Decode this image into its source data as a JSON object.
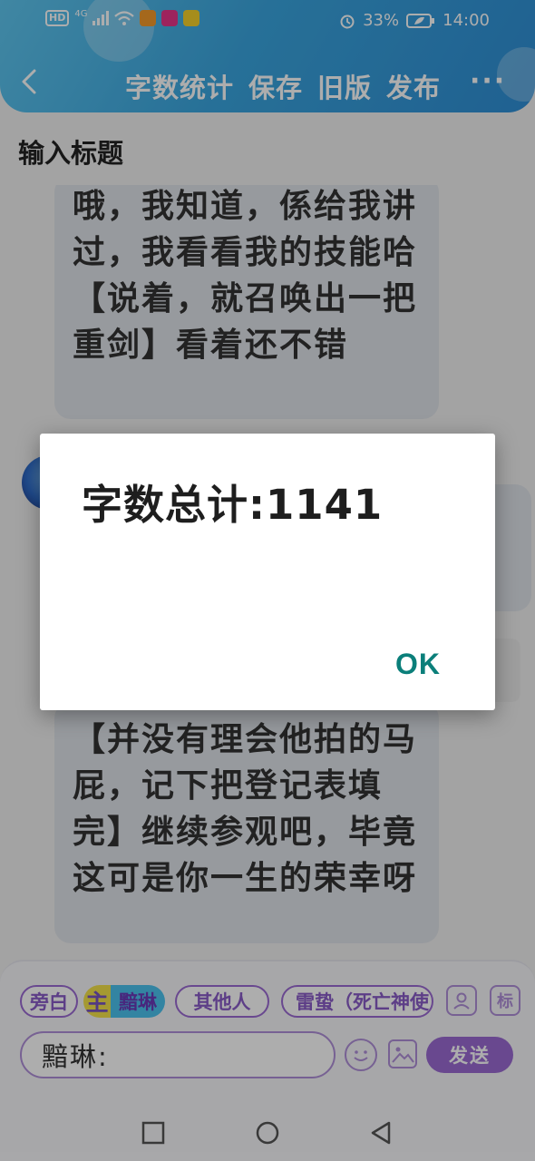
{
  "status_bar": {
    "left_badges": [
      "HD",
      "4G"
    ],
    "battery": "33%",
    "time": "14:00"
  },
  "navbar": {
    "items": [
      "字数统计",
      "保存",
      "旧版",
      "发布"
    ],
    "more": "···"
  },
  "title_placeholder": "输入标题",
  "messages": [
    "哦，我知道，係给我讲过，我看看我的技能哈【说着，就召唤出一把重剑】看着还不错",
    "【并没有理会他拍的马屁，记下把登记表填完】继续参观吧，毕竟这可是你一生的荣幸呀"
  ],
  "role_bar": {
    "narration": "旁白",
    "main_prefix": "主",
    "main_name": "黯琳",
    "others": "其他人",
    "role3": "雷蛰（死亡神使",
    "mark_label": "标"
  },
  "input": {
    "value": "黯琳:",
    "send": "发送"
  },
  "dialog": {
    "message": "字数总计:1141",
    "ok": "OK"
  },
  "colors": {
    "accent": "#9b6bd3",
    "dialog_ok": "#0b7f7a",
    "header": "#3aa6e0"
  }
}
